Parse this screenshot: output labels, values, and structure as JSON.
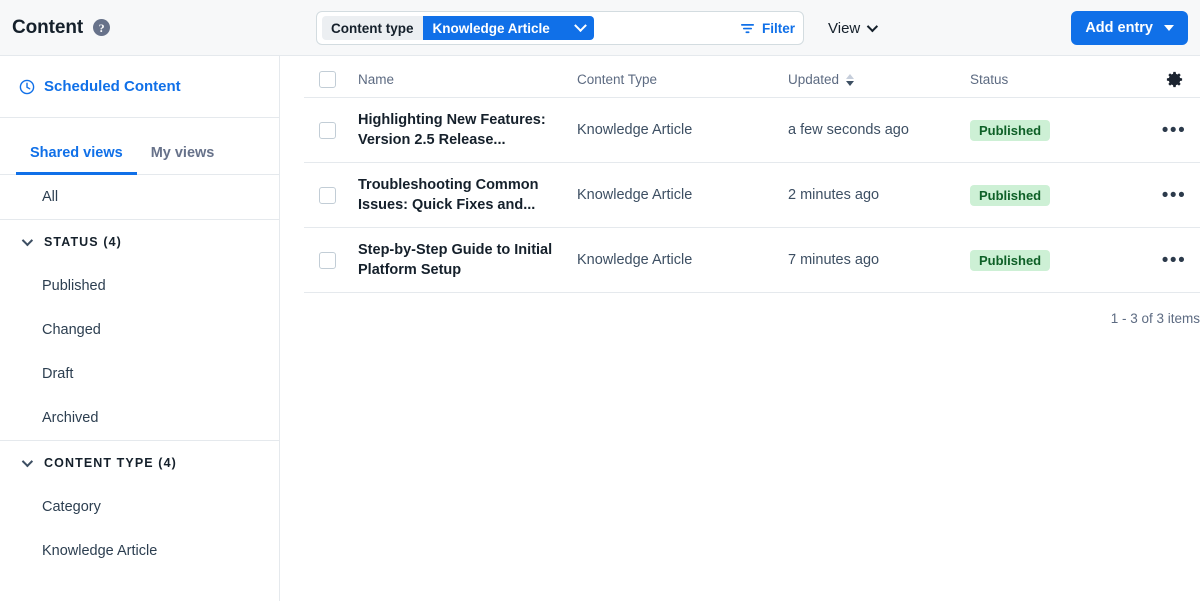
{
  "header": {
    "title": "Content",
    "help_icon": "help-circle-icon",
    "filter": {
      "pill_key": "Content type",
      "pill_value": "Knowledge Article",
      "pill_chevron_icon": "chevron-down-icon",
      "filter_button_label": "Filter",
      "filter_icon": "filter-funnel-icon"
    },
    "view": {
      "label": "View",
      "chevron_icon": "chevron-down-icon"
    },
    "add_entry": {
      "label": "Add entry",
      "caret_icon": "caret-down-icon"
    }
  },
  "sidebar": {
    "scheduled": {
      "label": "Scheduled Content",
      "icon": "clock-icon"
    },
    "tabs": [
      {
        "label": "Shared views",
        "active": true
      },
      {
        "label": "My views",
        "active": false
      }
    ],
    "all_item": "All",
    "groups": [
      {
        "label": "STATUS (4)",
        "chevron_icon": "chevron-down-icon",
        "items": [
          "Published",
          "Changed",
          "Draft",
          "Archived"
        ]
      },
      {
        "label": "CONTENT TYPE (4)",
        "chevron_icon": "chevron-down-icon",
        "items": [
          "Category",
          "Knowledge Article"
        ]
      }
    ]
  },
  "table": {
    "columns": {
      "name": "Name",
      "content_type": "Content Type",
      "updated": "Updated",
      "status": "Status"
    },
    "updated_sort_icon": "sort-descending-icon",
    "settings_icon": "gear-icon",
    "select_all_checkbox": "checkbox-unchecked",
    "rows": [
      {
        "name": "Highlighting New Features: Version 2.5 Release...",
        "content_type": "Knowledge Article",
        "updated": "a few seconds ago",
        "status": "Published",
        "menu_icon": "ellipsis-icon"
      },
      {
        "name": "Troubleshooting Common Issues: Quick Fixes and...",
        "content_type": "Knowledge Article",
        "updated": "2 minutes ago",
        "status": "Published",
        "menu_icon": "ellipsis-icon"
      },
      {
        "name": "Step-by-Step Guide to Initial Platform Setup",
        "content_type": "Knowledge Article",
        "updated": "7 minutes ago",
        "status": "Published",
        "menu_icon": "ellipsis-icon"
      }
    ],
    "pagination": "1 - 3 of 3 items"
  },
  "colors": {
    "accent_blue": "#1070e8",
    "badge_bg": "#cdf0d5",
    "badge_text": "#0e6027",
    "topbar_bg": "#f7f8f9",
    "border": "#e5e9ed"
  }
}
